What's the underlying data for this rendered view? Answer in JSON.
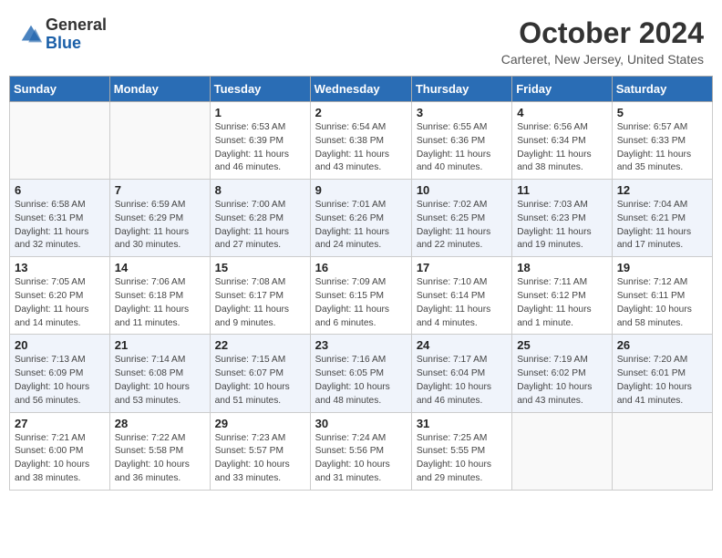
{
  "header": {
    "logo_general": "General",
    "logo_blue": "Blue",
    "month_title": "October 2024",
    "location": "Carteret, New Jersey, United States"
  },
  "days_of_week": [
    "Sunday",
    "Monday",
    "Tuesday",
    "Wednesday",
    "Thursday",
    "Friday",
    "Saturday"
  ],
  "weeks": [
    [
      {
        "day": "",
        "details": ""
      },
      {
        "day": "",
        "details": ""
      },
      {
        "day": "1",
        "details": "Sunrise: 6:53 AM\nSunset: 6:39 PM\nDaylight: 11 hours and 46 minutes."
      },
      {
        "day": "2",
        "details": "Sunrise: 6:54 AM\nSunset: 6:38 PM\nDaylight: 11 hours and 43 minutes."
      },
      {
        "day": "3",
        "details": "Sunrise: 6:55 AM\nSunset: 6:36 PM\nDaylight: 11 hours and 40 minutes."
      },
      {
        "day": "4",
        "details": "Sunrise: 6:56 AM\nSunset: 6:34 PM\nDaylight: 11 hours and 38 minutes."
      },
      {
        "day": "5",
        "details": "Sunrise: 6:57 AM\nSunset: 6:33 PM\nDaylight: 11 hours and 35 minutes."
      }
    ],
    [
      {
        "day": "6",
        "details": "Sunrise: 6:58 AM\nSunset: 6:31 PM\nDaylight: 11 hours and 32 minutes."
      },
      {
        "day": "7",
        "details": "Sunrise: 6:59 AM\nSunset: 6:29 PM\nDaylight: 11 hours and 30 minutes."
      },
      {
        "day": "8",
        "details": "Sunrise: 7:00 AM\nSunset: 6:28 PM\nDaylight: 11 hours and 27 minutes."
      },
      {
        "day": "9",
        "details": "Sunrise: 7:01 AM\nSunset: 6:26 PM\nDaylight: 11 hours and 24 minutes."
      },
      {
        "day": "10",
        "details": "Sunrise: 7:02 AM\nSunset: 6:25 PM\nDaylight: 11 hours and 22 minutes."
      },
      {
        "day": "11",
        "details": "Sunrise: 7:03 AM\nSunset: 6:23 PM\nDaylight: 11 hours and 19 minutes."
      },
      {
        "day": "12",
        "details": "Sunrise: 7:04 AM\nSunset: 6:21 PM\nDaylight: 11 hours and 17 minutes."
      }
    ],
    [
      {
        "day": "13",
        "details": "Sunrise: 7:05 AM\nSunset: 6:20 PM\nDaylight: 11 hours and 14 minutes."
      },
      {
        "day": "14",
        "details": "Sunrise: 7:06 AM\nSunset: 6:18 PM\nDaylight: 11 hours and 11 minutes."
      },
      {
        "day": "15",
        "details": "Sunrise: 7:08 AM\nSunset: 6:17 PM\nDaylight: 11 hours and 9 minutes."
      },
      {
        "day": "16",
        "details": "Sunrise: 7:09 AM\nSunset: 6:15 PM\nDaylight: 11 hours and 6 minutes."
      },
      {
        "day": "17",
        "details": "Sunrise: 7:10 AM\nSunset: 6:14 PM\nDaylight: 11 hours and 4 minutes."
      },
      {
        "day": "18",
        "details": "Sunrise: 7:11 AM\nSunset: 6:12 PM\nDaylight: 11 hours and 1 minute."
      },
      {
        "day": "19",
        "details": "Sunrise: 7:12 AM\nSunset: 6:11 PM\nDaylight: 10 hours and 58 minutes."
      }
    ],
    [
      {
        "day": "20",
        "details": "Sunrise: 7:13 AM\nSunset: 6:09 PM\nDaylight: 10 hours and 56 minutes."
      },
      {
        "day": "21",
        "details": "Sunrise: 7:14 AM\nSunset: 6:08 PM\nDaylight: 10 hours and 53 minutes."
      },
      {
        "day": "22",
        "details": "Sunrise: 7:15 AM\nSunset: 6:07 PM\nDaylight: 10 hours and 51 minutes."
      },
      {
        "day": "23",
        "details": "Sunrise: 7:16 AM\nSunset: 6:05 PM\nDaylight: 10 hours and 48 minutes."
      },
      {
        "day": "24",
        "details": "Sunrise: 7:17 AM\nSunset: 6:04 PM\nDaylight: 10 hours and 46 minutes."
      },
      {
        "day": "25",
        "details": "Sunrise: 7:19 AM\nSunset: 6:02 PM\nDaylight: 10 hours and 43 minutes."
      },
      {
        "day": "26",
        "details": "Sunrise: 7:20 AM\nSunset: 6:01 PM\nDaylight: 10 hours and 41 minutes."
      }
    ],
    [
      {
        "day": "27",
        "details": "Sunrise: 7:21 AM\nSunset: 6:00 PM\nDaylight: 10 hours and 38 minutes."
      },
      {
        "day": "28",
        "details": "Sunrise: 7:22 AM\nSunset: 5:58 PM\nDaylight: 10 hours and 36 minutes."
      },
      {
        "day": "29",
        "details": "Sunrise: 7:23 AM\nSunset: 5:57 PM\nDaylight: 10 hours and 33 minutes."
      },
      {
        "day": "30",
        "details": "Sunrise: 7:24 AM\nSunset: 5:56 PM\nDaylight: 10 hours and 31 minutes."
      },
      {
        "day": "31",
        "details": "Sunrise: 7:25 AM\nSunset: 5:55 PM\nDaylight: 10 hours and 29 minutes."
      },
      {
        "day": "",
        "details": ""
      },
      {
        "day": "",
        "details": ""
      }
    ]
  ]
}
